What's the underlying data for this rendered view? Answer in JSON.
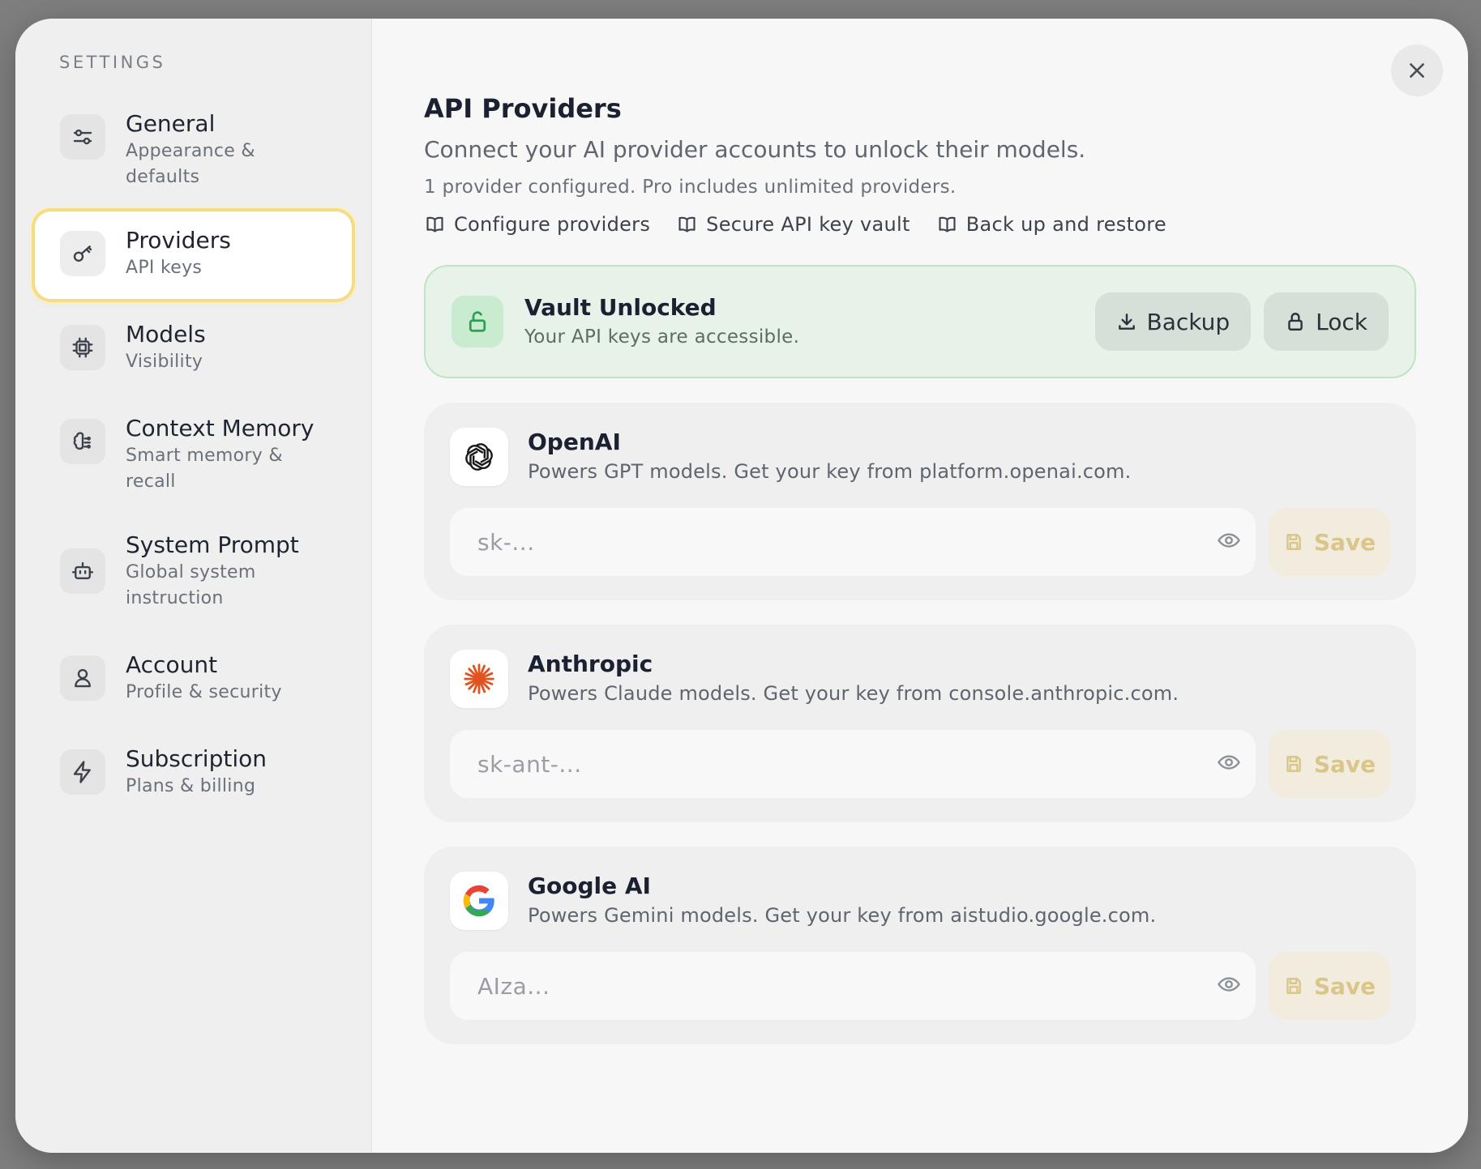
{
  "sidebar": {
    "title": "SETTINGS",
    "items": [
      {
        "label": "General",
        "sub": "Appearance & defaults",
        "icon": "sliders-icon"
      },
      {
        "label": "Providers",
        "sub": "API keys",
        "icon": "key-icon",
        "active": true
      },
      {
        "label": "Models",
        "sub": "Visibility",
        "icon": "cpu-chip-icon"
      },
      {
        "label": "Context Memory",
        "sub": "Smart memory & recall",
        "icon": "brain-icon"
      },
      {
        "label": "System Prompt",
        "sub": "Global system instruction",
        "icon": "bot-icon"
      },
      {
        "label": "Account",
        "sub": "Profile & security",
        "icon": "user-icon"
      },
      {
        "label": "Subscription",
        "sub": "Plans & billing",
        "icon": "lightning-icon"
      }
    ]
  },
  "main": {
    "title": "API Providers",
    "description": "Connect your AI provider accounts to unlock their models.",
    "note": "1 provider configured. Pro includes unlimited providers.",
    "doc_links": [
      "Configure providers",
      "Secure API key vault",
      "Back up and restore"
    ]
  },
  "vault": {
    "title": "Vault Unlocked",
    "subtitle": "Your API keys are accessible.",
    "backup_label": "Backup",
    "lock_label": "Lock",
    "accent": "#2e9e52"
  },
  "providers": [
    {
      "name": "OpenAI",
      "description": "Powers GPT models. Get your key from platform.openai.com.",
      "placeholder": "sk-...",
      "save_label": "Save",
      "icon": "openai-logo-icon"
    },
    {
      "name": "Anthropic",
      "description": "Powers Claude models. Get your key from console.anthropic.com.",
      "placeholder": "sk-ant-...",
      "save_label": "Save",
      "icon": "anthropic-logo-icon"
    },
    {
      "name": "Google AI",
      "description": "Powers Gemini models. Get your key from aistudio.google.com.",
      "placeholder": "AIza...",
      "save_label": "Save",
      "icon": "google-logo-icon"
    }
  ],
  "colors": {
    "active_outline": "#f5dc87",
    "save_text": "#d9c68a",
    "anthropic": "#e0531f"
  }
}
